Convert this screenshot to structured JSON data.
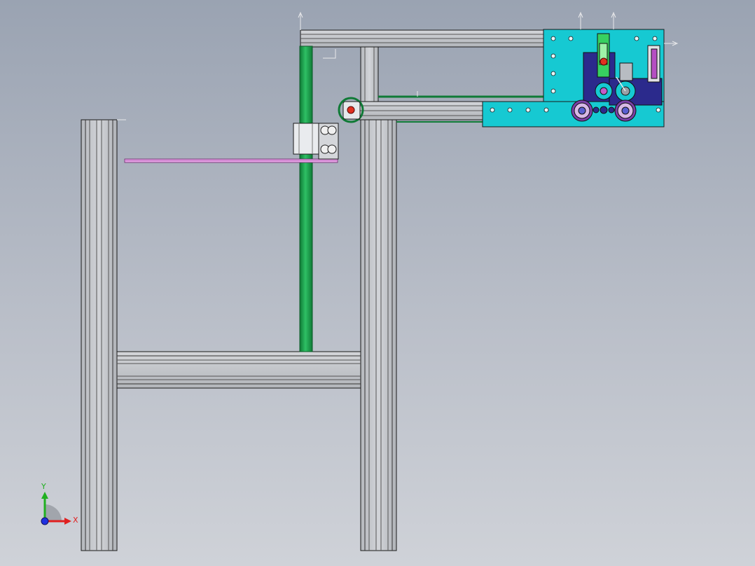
{
  "triad": {
    "x_label": "X",
    "y_label": "Y",
    "x_color": "#e02020",
    "y_color": "#20b020",
    "z_color": "#2030e0"
  },
  "colors": {
    "background_top": "#9aa3b2",
    "background_bottom": "#cfd2d8",
    "aluminum_profile": "#c4c7cc",
    "profile_groove": "#9a9da3",
    "guide_rod": "#1aa04a",
    "mount_plate": "#14c8d0",
    "bracket_dark": "#2a2a8a",
    "pink_rail": "#e08ce0",
    "outline": "#1a1a1a"
  }
}
